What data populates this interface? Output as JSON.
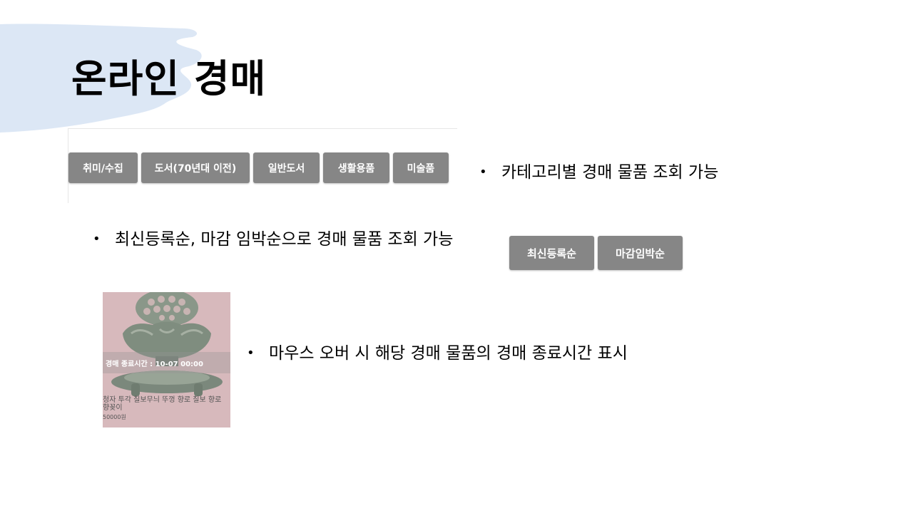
{
  "slide": {
    "title": "온라인 경매",
    "accent_color": "#dce7f5"
  },
  "categories": [
    {
      "label": "취미/수집"
    },
    {
      "label": "도서(70년대 이전)"
    },
    {
      "label": "일반도서"
    },
    {
      "label": "생활용품"
    },
    {
      "label": "미술품"
    }
  ],
  "bullets": {
    "category": "카테고리별 경매 물품 조회 가능",
    "sort": "최신등록순, 마감 임박순으로 경매 물품 조회 가능",
    "hover": "마우스 오버 시  해당 경매 물품의 경매 종료시간 표시"
  },
  "sort_buttons": {
    "latest": "최신등록순",
    "deadline": "마감임박순"
  },
  "item_card": {
    "end_time": "경매 종료시간 : 10-07 00:00",
    "name": "청자 투각 칠보무늬 뚜껑 향로 칠보 향로 향꽂이",
    "price": "50000원",
    "bg_color": "#d7b9bc"
  },
  "button_color": "#868686"
}
